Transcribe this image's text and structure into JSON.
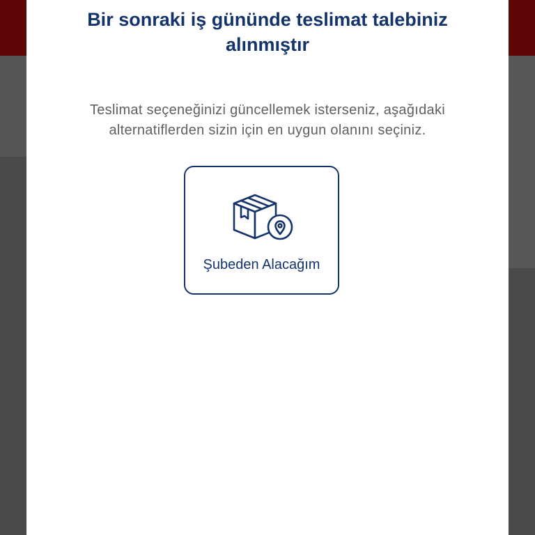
{
  "dialog": {
    "title": "Bir sonraki iş gününde teslimat talebiniz alınmıştır",
    "description": "Teslimat seçeneğinizi güncellemek isterseniz, aşağıdaki alternatiflerden sizin için en uygun olanını seçiniz.",
    "options": [
      {
        "label": "Şubeden Alacağım",
        "icon": "package-location-icon"
      }
    ]
  },
  "colors": {
    "primary": "#15336b",
    "text_muted": "#5f5f5f",
    "header_bg": "#5e0709",
    "overlay_bg": "#4a4a4a",
    "modal_bg": "#ffffff"
  }
}
